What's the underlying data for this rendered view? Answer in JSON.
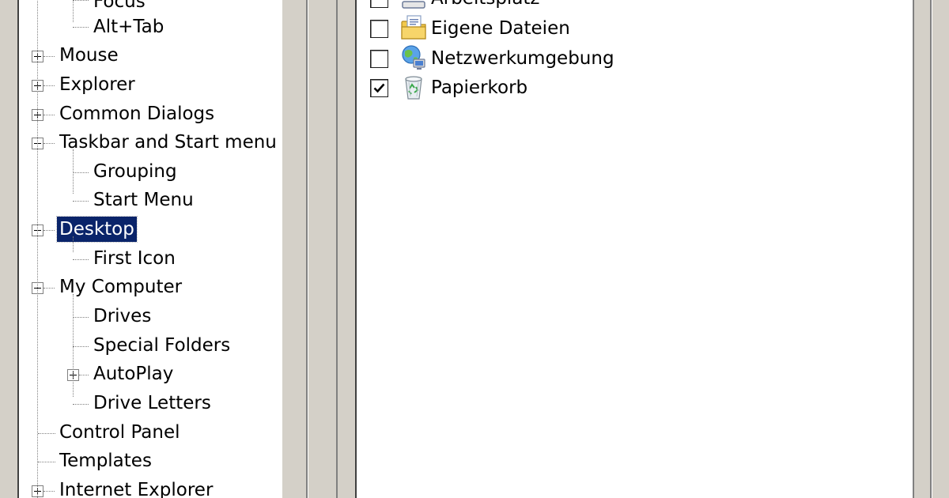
{
  "tree": {
    "items": [
      {
        "label": "Focus",
        "level": 2
      },
      {
        "label": "Alt+Tab",
        "level": 2
      },
      {
        "label": "Mouse",
        "level": 1,
        "expander": "plus"
      },
      {
        "label": "Explorer",
        "level": 1,
        "expander": "plus"
      },
      {
        "label": "Common Dialogs",
        "level": 1,
        "expander": "plus"
      },
      {
        "label": "Taskbar and Start menu",
        "level": 1,
        "expander": "minus"
      },
      {
        "label": "Grouping",
        "level": 2
      },
      {
        "label": "Start Menu",
        "level": 2
      },
      {
        "label": "Desktop",
        "level": 1,
        "expander": "minus",
        "selected": true
      },
      {
        "label": "First Icon",
        "level": 2
      },
      {
        "label": "My Computer",
        "level": 1,
        "expander": "minus"
      },
      {
        "label": "Drives",
        "level": 2
      },
      {
        "label": "Special Folders",
        "level": 2
      },
      {
        "label": "AutoPlay",
        "level": 2,
        "expander": "plus"
      },
      {
        "label": "Drive Letters",
        "level": 2
      },
      {
        "label": "Control Panel",
        "level": 1
      },
      {
        "label": "Templates",
        "level": 1
      },
      {
        "label": "Internet Explorer",
        "level": 1,
        "expander": "plus"
      }
    ]
  },
  "list": {
    "items": [
      {
        "label": "Arbeitsplatz",
        "checked": false,
        "icon": "computer-icon"
      },
      {
        "label": "Eigene Dateien",
        "checked": false,
        "icon": "documents-folder-icon"
      },
      {
        "label": "Netzwerkumgebung",
        "checked": false,
        "icon": "network-icon"
      },
      {
        "label": "Papierkorb",
        "checked": true,
        "icon": "recycle-bin-icon"
      }
    ]
  },
  "colors": {
    "selection": "#0a246a",
    "face": "#d4d0c8",
    "window": "#ffffff"
  }
}
